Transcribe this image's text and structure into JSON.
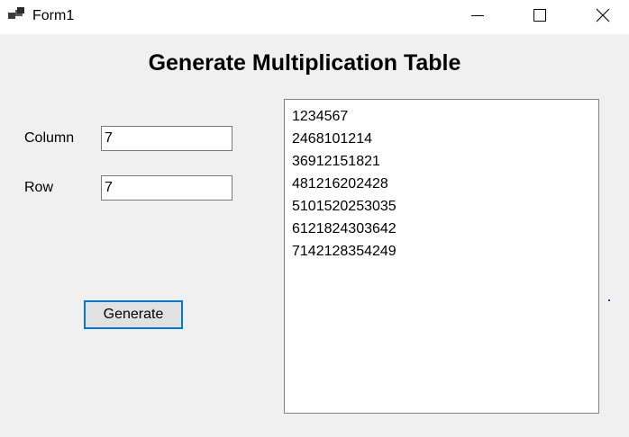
{
  "window": {
    "title": "Form1",
    "app_icon": "form-app-icon",
    "controls": {
      "minimize_icon": "minimize-icon",
      "maximize_icon": "maximize-icon",
      "close_icon": "close-icon"
    }
  },
  "form": {
    "heading": "Generate Multiplication Table",
    "column_label": "Column",
    "column_value": "7",
    "row_label": "Row",
    "row_value": "7",
    "generate_label": "Generate"
  },
  "output": {
    "lines": [
      "1234567",
      "2468101214",
      "36912151821",
      "481216202428",
      "5101520253035",
      "6121824303642",
      "7142128354249"
    ]
  },
  "colors": {
    "focus_border": "#0078d7",
    "window_bg": "#f0f0f0",
    "titlebar_bg": "#ffffff"
  }
}
